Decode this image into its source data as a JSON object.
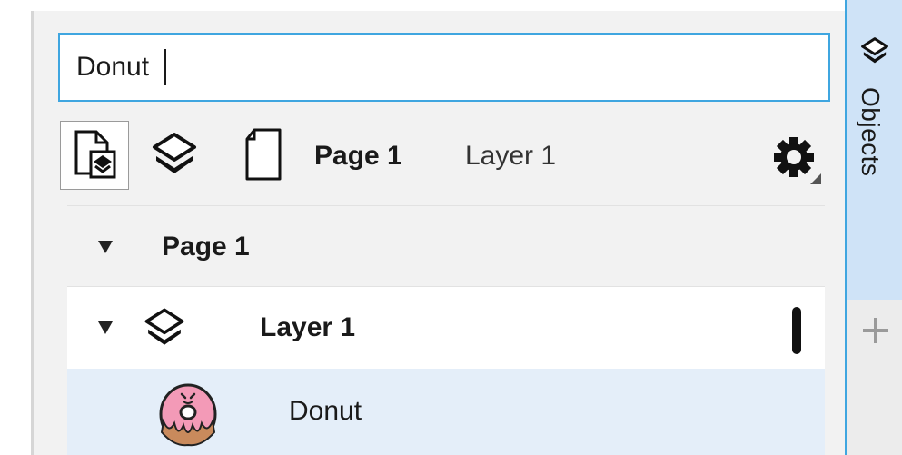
{
  "search": {
    "value": "Donut"
  },
  "toolbar": {
    "breadcrumb_page": "Page 1",
    "breadcrumb_layer": "Layer 1",
    "active_view": "page-view",
    "icons": [
      "page-view-icon",
      "layers-icon",
      "page-icon",
      "gear-icon"
    ]
  },
  "tree": {
    "page": {
      "label": "Page 1",
      "expanded": true
    },
    "layer": {
      "label": "Layer 1",
      "expanded": true
    },
    "object": {
      "label": "Donut",
      "selected": true
    }
  },
  "side_tabs": {
    "objects": {
      "label": "Objects",
      "icon": "objects-icon"
    },
    "add": {
      "icon": "plus-icon"
    }
  },
  "colors": {
    "accent": "#3fa6e0",
    "selection": "#e4eef9",
    "tab_active": "#cfe3f7",
    "donut_pink": "#f39ab7"
  }
}
